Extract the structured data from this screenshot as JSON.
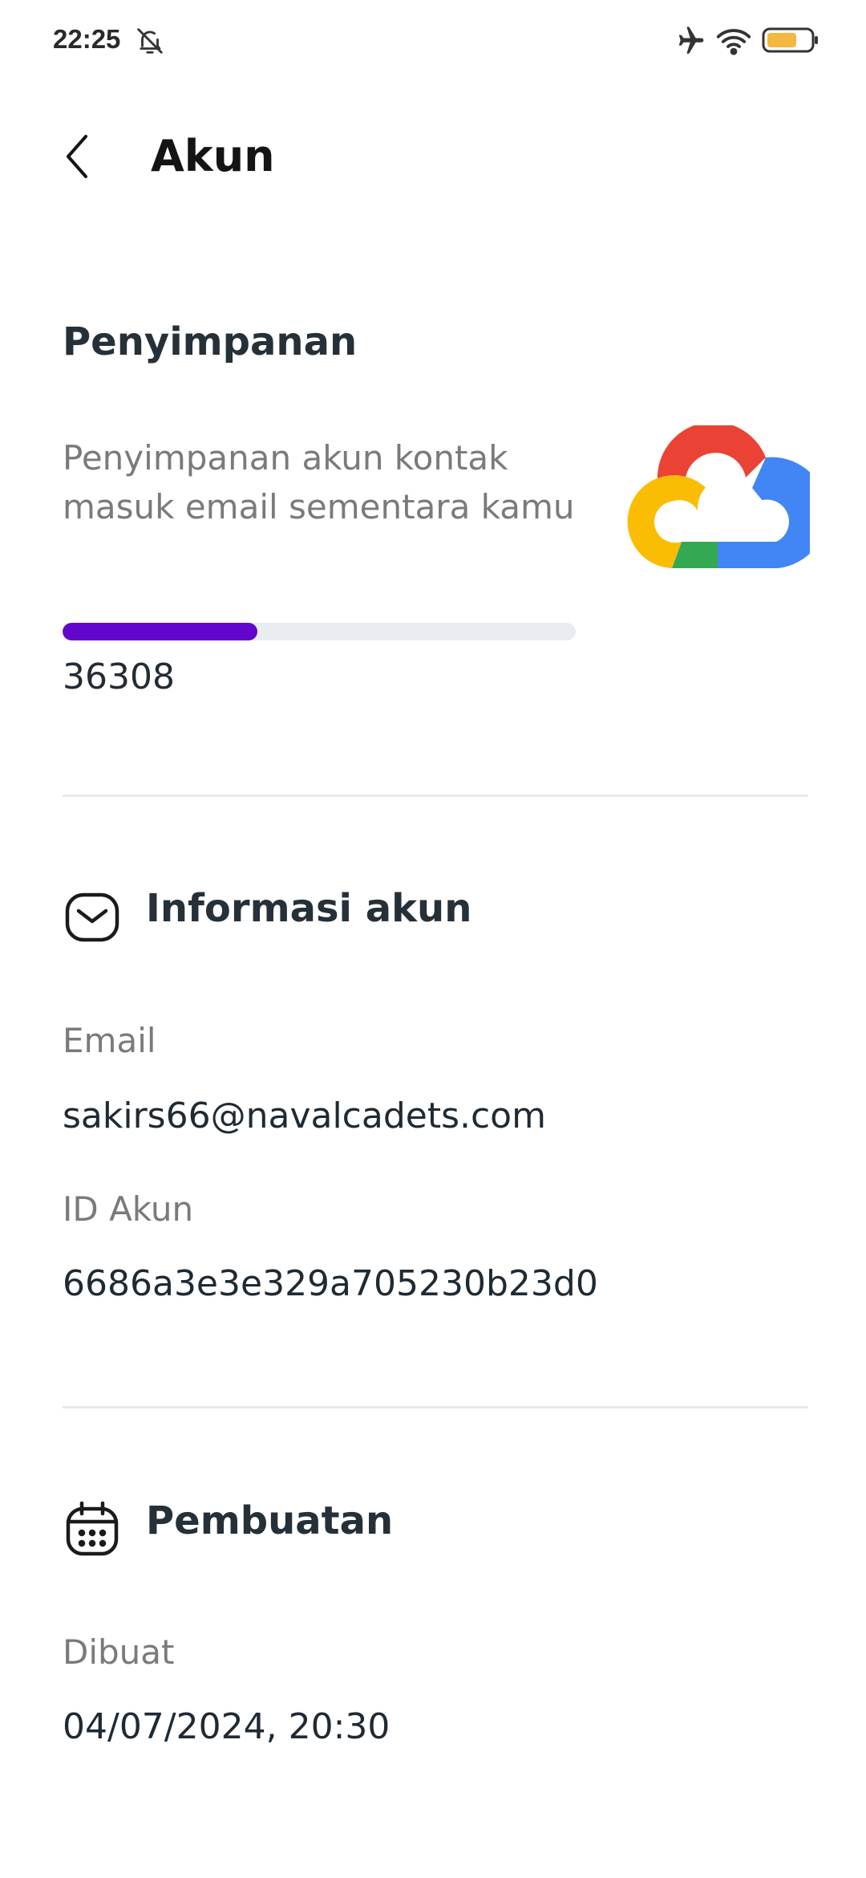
{
  "status_bar": {
    "time": "22:25",
    "icons": [
      "bell-off-icon",
      "airplane-icon",
      "wifi-icon",
      "battery-icon"
    ],
    "battery_level": 0.7
  },
  "header": {
    "back_icon": "chevron-left-icon",
    "title": "Akun"
  },
  "storage": {
    "title": "Penyimpanan",
    "description": "Penyimpanan akun kontak masuk email sementara kamu",
    "progress_fraction": 0.38,
    "count": "36308",
    "logo": "google-cloud-logo",
    "accent_color": "#6305cc"
  },
  "account_info": {
    "title": "Informasi akun",
    "icon": "envelope-icon",
    "email_label": "Email",
    "email_value": "sakirs66@navalcadets.com",
    "id_label": "ID Akun",
    "id_value": "6686a3e3e329a705230b23d0"
  },
  "creation": {
    "title": "Pembuatan",
    "icon": "calendar-icon",
    "created_label": "Dibuat",
    "created_value": "04/07/2024, 20:30"
  }
}
